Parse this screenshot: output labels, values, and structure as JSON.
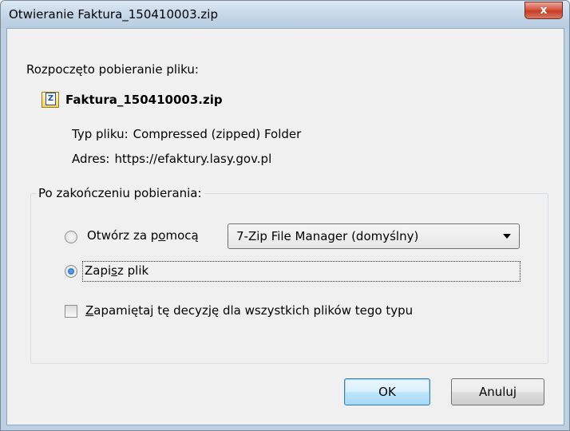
{
  "window": {
    "title": "Otwieranie Faktura_150410003.zip",
    "close_label": "x"
  },
  "download": {
    "heading": "Rozpoczęto pobieranie pliku:",
    "icon": "zip-archive-icon",
    "file_name": "Faktura_150410003.zip",
    "type_label": "Typ pliku:",
    "type_value": "Compressed (zipped) Folder",
    "address_label": "Adres:",
    "address_value": "https://efaktury.lasy.gov.pl"
  },
  "after_download": {
    "group_label": "Po zakończeniu pobierania:",
    "open_with": {
      "label_before": "Otwórz za p",
      "label_underlined": "o",
      "label_after": "mocą",
      "checked": false
    },
    "app_select": {
      "selected": "7-Zip File Manager (domyślny)"
    },
    "save_file": {
      "label_before": "Zapi",
      "label_underlined": "s",
      "label_after": "z plik",
      "checked": true
    },
    "remember": {
      "label_underlined": "Z",
      "label_after": "apamiętaj tę decyzję dla wszystkich plików tego typu",
      "checked": false
    }
  },
  "buttons": {
    "ok": "OK",
    "cancel": "Anuluj"
  },
  "colors": {
    "accent": "#1b5fb5",
    "close_button": "#c63c25"
  }
}
